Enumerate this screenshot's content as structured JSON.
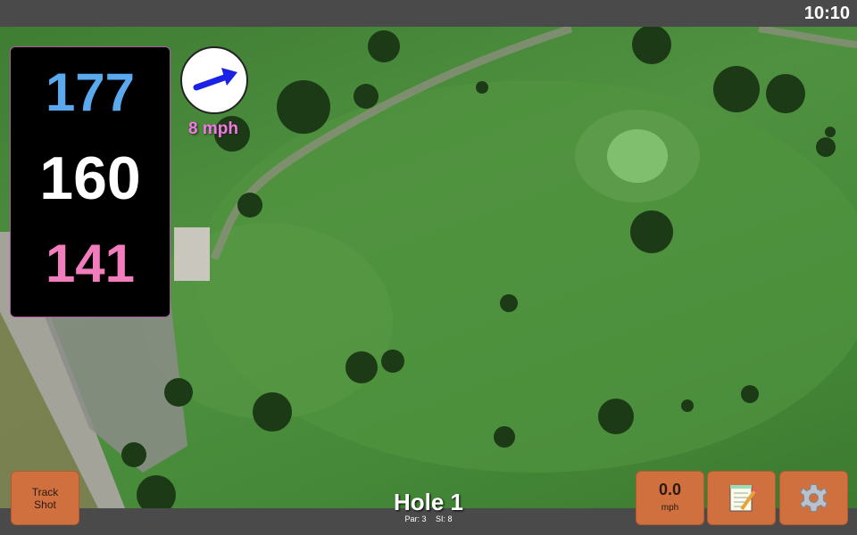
{
  "status_bar": {
    "time": "10:10"
  },
  "distances": {
    "back": "177",
    "middle": "160",
    "front": "141"
  },
  "wind": {
    "speed": "8 mph",
    "arrow_color": "#1a22e6"
  },
  "buttons": {
    "track_shot_line1": "Track",
    "track_shot_line2": "Shot",
    "speed_value": "0.0",
    "speed_unit": "mph",
    "notes_icon": "notepad-icon",
    "settings_icon": "gear-icon"
  },
  "hole": {
    "title": "Hole 1",
    "par": "Par: 3",
    "si": "SI: 8"
  },
  "colors": {
    "back": "#5aa9ee",
    "front": "#f27dbc",
    "button_accent": "#d0703f",
    "wind_text": "#ef7ae0"
  }
}
